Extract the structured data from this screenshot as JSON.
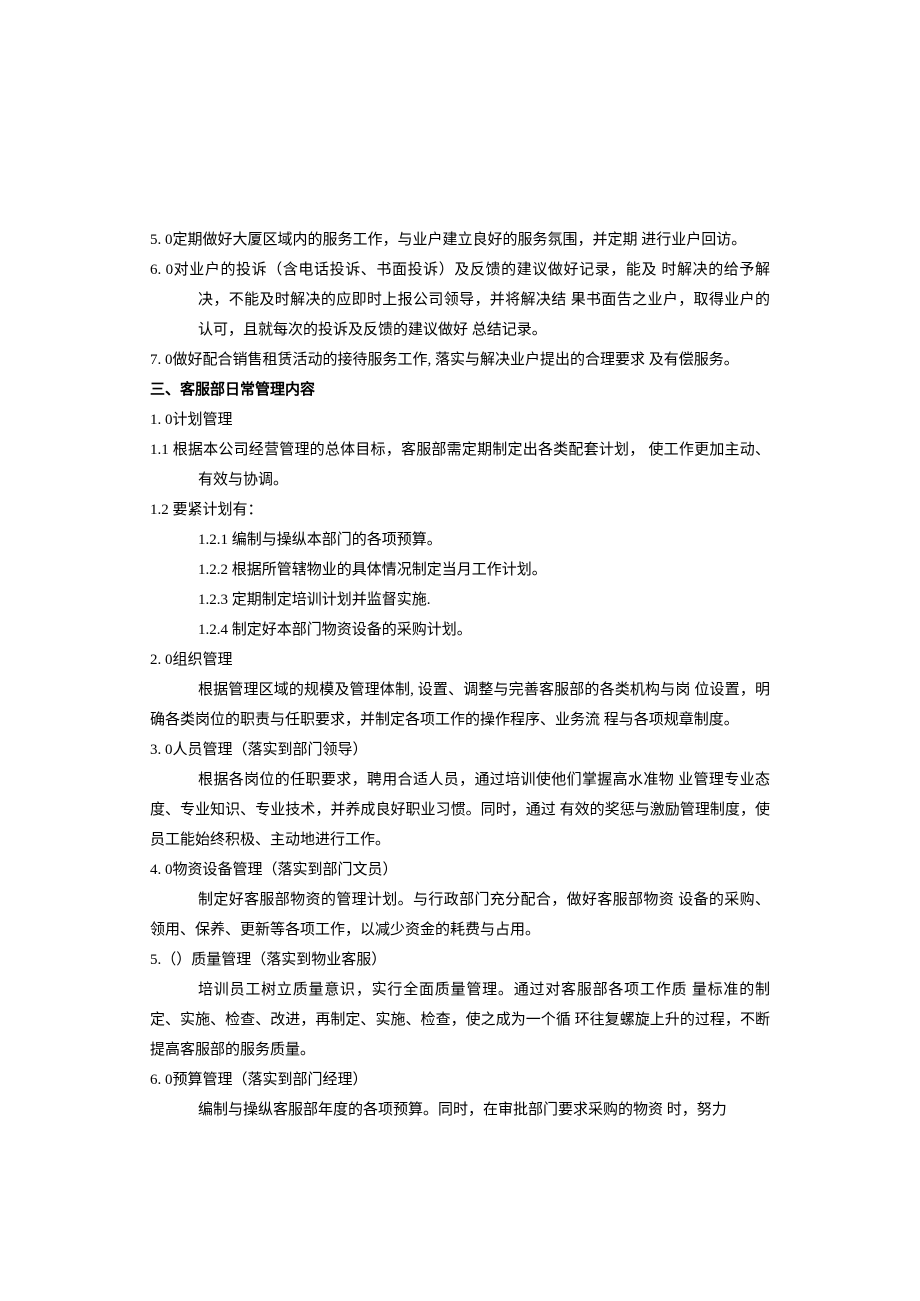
{
  "items": [
    {
      "cls": "para hang",
      "text": "5. 0定期做好大厦区域内的服务工作，与业户建立良好的服务氛围，并定期  进行业户回访。"
    },
    {
      "cls": "para hang",
      "text": "6. 0对业户的投诉（含电话投诉、书面投诉）及反馈的建议做好记录，能及  时解决的给予解决，不能及时解决的应即时上报公司领导，并将解决结    果书面告之业户，取得业户的认可，且就每次的投诉及反馈的建议做好 总结记录。"
    },
    {
      "cls": "para",
      "text": "7.  0做好配合销售租赁活动的接待服务工作, 落实与解决业户提出的合理要求 及有偿服务。"
    },
    {
      "cls": "para bold",
      "text": "三、客服部日常管理内容"
    },
    {
      "cls": "para",
      "text": "1. 0计划管理"
    },
    {
      "cls": "para hang",
      "text": "1.1 根据本公司经营管理的总体目标，客服部需定期制定出各类配套计划，  使工作更加主动、有效与协调。"
    },
    {
      "cls": "para",
      "text": "1.2   要紧计划有："
    },
    {
      "cls": "para indent1",
      "text": "1.2.1   编制与操纵本部门的各项预算。"
    },
    {
      "cls": "para indent1",
      "text": "1.2.2   根据所管辖物业的具体情况制定当月工作计划。"
    },
    {
      "cls": "para indent1",
      "text": "1.2.3   定期制定培训计划并监督实施."
    },
    {
      "cls": "para indent1",
      "text": "1.2.4   制定好本部门物资设备的采购计划。"
    },
    {
      "cls": "para",
      "text": "2. 0组织管理"
    },
    {
      "cls": "para run-indent",
      "text": "根据管理区域的规模及管理体制, 设置、调整与完善客服部的各类机构与岗 位设置，明确各类岗位的职责与任职要求，并制定各项工作的操作程序、业务流 程与各项规章制度。"
    },
    {
      "cls": "para",
      "text": "3. 0人员管理（落实到部门领导）"
    },
    {
      "cls": "para run-indent",
      "text": "根据各岗位的任职要求，聘用合适人员，通过培训使他们掌握高水准物 业管理专业态度、专业知识、专业技术，并养成良好职业习惯。同时，通过 有效的奖惩与激励管理制度，使员工能始终积极、主动地进行工作。"
    },
    {
      "cls": "para",
      "text": "4. 0物资设备管理（落实到部门文员）"
    },
    {
      "cls": "para run-indent",
      "text": "制定好客服部物资的管理计划。与行政部门充分配合，做好客服部物资 设备的采购、领用、保养、更新等各项工作，以减少资金的耗费与占用。"
    },
    {
      "cls": "para",
      "text": "5.（）质量管理（落实到物业客服）"
    },
    {
      "cls": "para run-indent",
      "text": "培训员工树立质量意识，实行全面质量管理。通过对客服部各项工作质 量标准的制定、实施、检查、改进，再制定、实施、检查，使之成为一个循 环往复螺旋上升的过程，不断提高客服部的服务质量。"
    },
    {
      "cls": "para",
      "text": "6. 0预算管理（落实到部门经理）"
    },
    {
      "cls": "para run-indent",
      "text": "编制与操纵客服部年度的各项预算。同时，在审批部门要求采购的物资 时，努力"
    }
  ]
}
